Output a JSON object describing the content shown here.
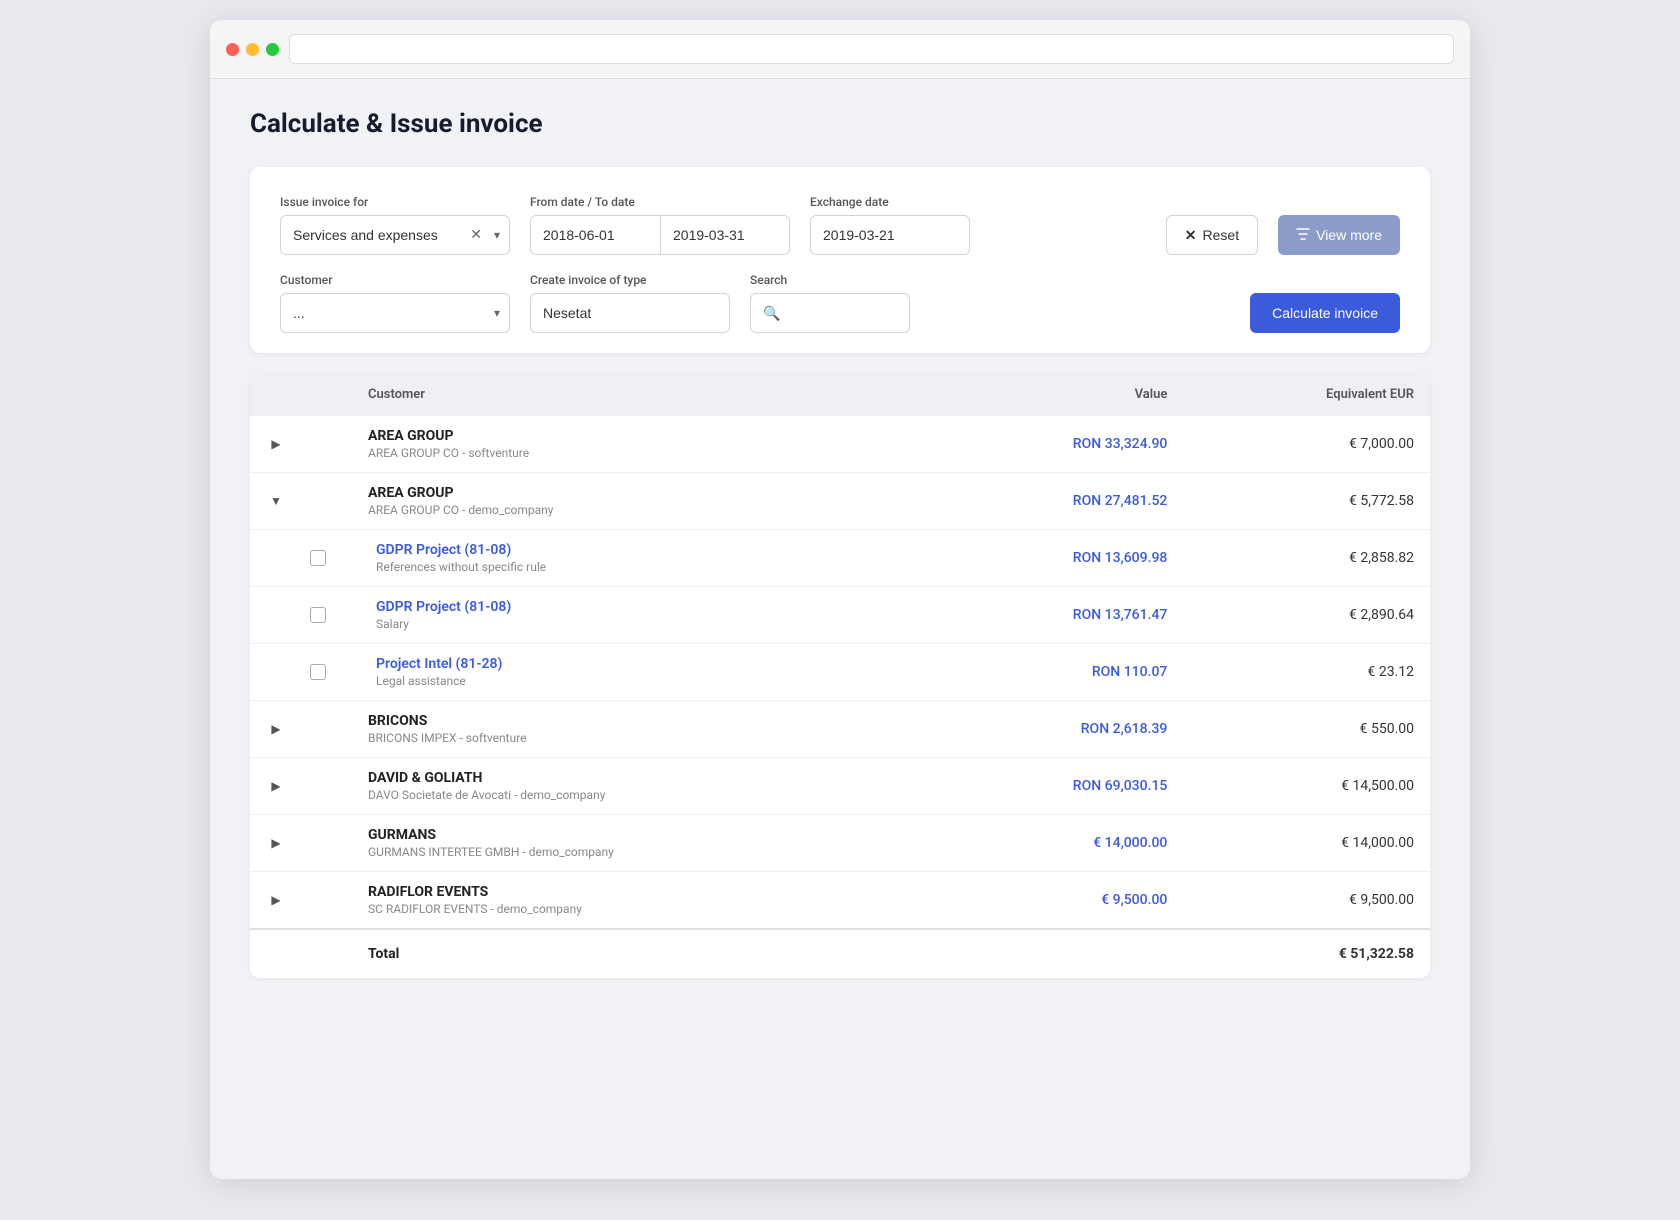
{
  "window": {
    "titlebar": {
      "traffic_red": "red",
      "traffic_yellow": "yellow",
      "traffic_green": "green"
    }
  },
  "page": {
    "title": "Calculate & Issue invoice"
  },
  "filters": {
    "issue_invoice_label": "Issue invoice for",
    "issue_invoice_value": "Services and expenses",
    "from_date_label": "From date / To date",
    "from_date_value": "2018-06-01",
    "to_date_value": "2019-03-31",
    "exchange_date_label": "Exchange date",
    "exchange_date_value": "2019-03-21",
    "customer_label": "Customer",
    "customer_placeholder": "...",
    "invoice_type_label": "Create invoice of type",
    "invoice_type_value": "Nesetat",
    "search_label": "Search",
    "search_placeholder": "🔍",
    "reset_label": "Reset",
    "view_more_label": "View more",
    "calculate_label": "Calculate invoice"
  },
  "table": {
    "col_customer": "Customer",
    "col_value": "Value",
    "col_eur": "Equivalent EUR",
    "rows": [
      {
        "id": "row1",
        "expandable": true,
        "expanded": false,
        "indent": 0,
        "name": "AREA GROUP",
        "sub": "AREA GROUP CO - softventure",
        "value": "RON 33,324.90",
        "eur": "€ 7,000.00",
        "is_project": false
      },
      {
        "id": "row2",
        "expandable": true,
        "expanded": true,
        "indent": 0,
        "name": "AREA GROUP",
        "sub": "AREA GROUP CO - demo_company",
        "value": "RON 27,481.52",
        "eur": "€ 5,772.58",
        "is_project": false
      },
      {
        "id": "row2a",
        "expandable": false,
        "expanded": false,
        "indent": 1,
        "name": "GDPR Project (81-08)",
        "sub": "References without specific rule",
        "value": "RON 13,609.98",
        "eur": "€ 2,858.82",
        "is_project": true,
        "has_checkbox": true
      },
      {
        "id": "row2b",
        "expandable": false,
        "expanded": false,
        "indent": 1,
        "name": "GDPR Project (81-08)",
        "sub": "Salary",
        "value": "RON 13,761.47",
        "eur": "€ 2,890.64",
        "is_project": true,
        "has_checkbox": true
      },
      {
        "id": "row2c",
        "expandable": false,
        "expanded": false,
        "indent": 1,
        "name": "Project Intel (81-28)",
        "sub": "Legal assistance",
        "value": "RON 110.07",
        "eur": "€ 23.12",
        "is_project": true,
        "has_checkbox": true
      },
      {
        "id": "row3",
        "expandable": true,
        "expanded": false,
        "indent": 0,
        "name": "BRICONS",
        "sub": "BRICONS IMPEX - softventure",
        "value": "RON 2,618.39",
        "eur": "€ 550.00",
        "is_project": false
      },
      {
        "id": "row4",
        "expandable": true,
        "expanded": false,
        "indent": 0,
        "name": "DAVID & GOLIATH",
        "sub": "DAVO Societate de Avocati - demo_company",
        "value": "RON 69,030.15",
        "eur": "€ 14,500.00",
        "is_project": false
      },
      {
        "id": "row5",
        "expandable": true,
        "expanded": false,
        "indent": 0,
        "name": "GURMANS",
        "sub": "GURMANS INTERTEE GMBH - demo_company",
        "value": "€ 14,000.00",
        "eur": "€ 14,000.00",
        "is_project": false
      },
      {
        "id": "row6",
        "expandable": true,
        "expanded": false,
        "indent": 0,
        "name": "RADIFLOR EVENTS",
        "sub": "SC RADIFLOR EVENTS - demo_company",
        "value": "€ 9,500.00",
        "eur": "€ 9,500.00",
        "is_project": false
      }
    ],
    "total_label": "Total",
    "total_value": "€ 51,322.58"
  }
}
